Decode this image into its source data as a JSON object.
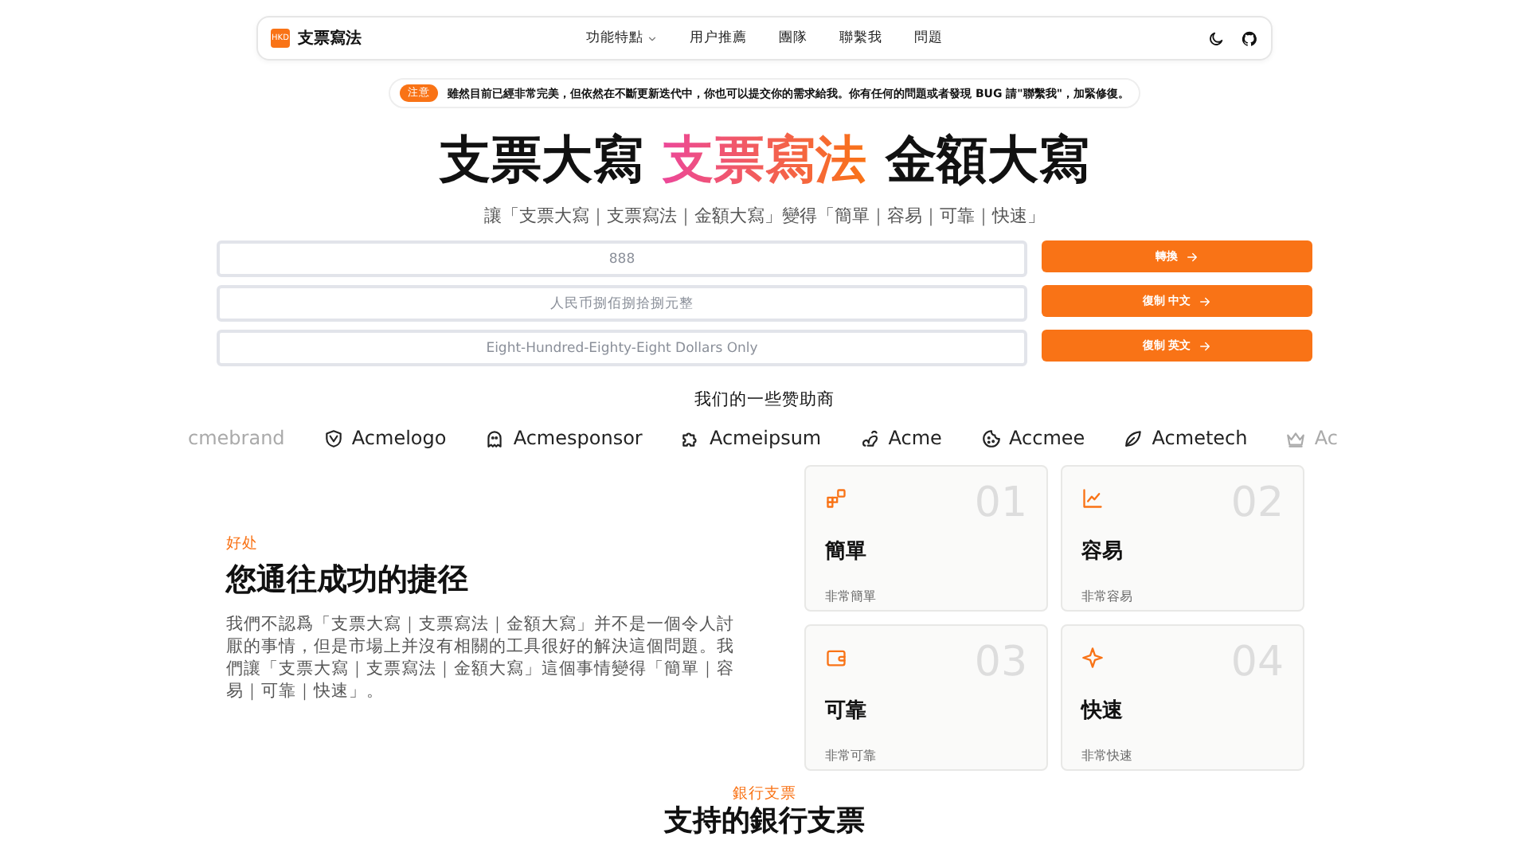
{
  "nav": {
    "logo_badge": "HKD",
    "brand": "支票寫法",
    "links": [
      {
        "label": "功能特點",
        "dropdown": true
      },
      {
        "label": "用户推薦",
        "dropdown": false
      },
      {
        "label": "團隊",
        "dropdown": false
      },
      {
        "label": "聯繫我",
        "dropdown": false
      },
      {
        "label": "問題",
        "dropdown": false
      }
    ]
  },
  "notice": {
    "tag": "注意",
    "text": "雖然目前已經非常完美，但依然在不斷更新迭代中，你也可以提交你的需求給我。你有任何的問題或者發現 BUG 請\"聯繫我\"，加緊修復。"
  },
  "hero": {
    "title": [
      {
        "text": "支票大寫",
        "kind": "plain"
      },
      {
        "text": "支票寫法",
        "kind": "highlight"
      },
      {
        "text": "金額大寫",
        "kind": "plain"
      }
    ],
    "subtitle": "讓「支票大寫｜支票寫法｜金額大寫」變得「簡單｜容易｜可靠｜快速」"
  },
  "converter": [
    {
      "value": "888",
      "button": "轉換"
    },
    {
      "value": "人民币捌佰捌拾捌元整",
      "button": "復制 中文"
    },
    {
      "value": "Eight-Hundred-Eighty-Eight Dollars Only",
      "button": "復制 英文"
    }
  ],
  "sponsors": {
    "title": "我们的一些赞助商",
    "items": [
      {
        "name": "cmebrand",
        "faded": true
      },
      {
        "name": "Acmelogo",
        "faded": false
      },
      {
        "name": "Acmesponsor",
        "faded": false
      },
      {
        "name": "Acmeipsum",
        "faded": false
      },
      {
        "name": "Acme",
        "faded": false
      },
      {
        "name": "Accmee",
        "faded": false
      },
      {
        "name": "Acmetech",
        "faded": false
      },
      {
        "name": "Ac",
        "faded": true
      }
    ]
  },
  "benefits": {
    "eyebrow": "好处",
    "heading": "您通往成功的捷径",
    "body": "我們不認爲「支票大寫｜支票寫法｜金額大寫」并不是一個令人討厭的事情，但是市場上并沒有相關的工具很好的解決這個問題。我們讓「支票大寫｜支票寫法｜金額大寫」這個事情變得「簡單｜容易｜可靠｜快速」。",
    "cards": [
      {
        "number": "01",
        "title": "簡單",
        "text": "非常簡單"
      },
      {
        "number": "02",
        "title": "容易",
        "text": "非常容易"
      },
      {
        "number": "03",
        "title": "可靠",
        "text": "非常可靠"
      },
      {
        "number": "04",
        "title": "快速",
        "text": "非常快速"
      }
    ]
  },
  "next_section": {
    "eyebrow": "銀行支票",
    "heading": "支持的銀行支票"
  }
}
